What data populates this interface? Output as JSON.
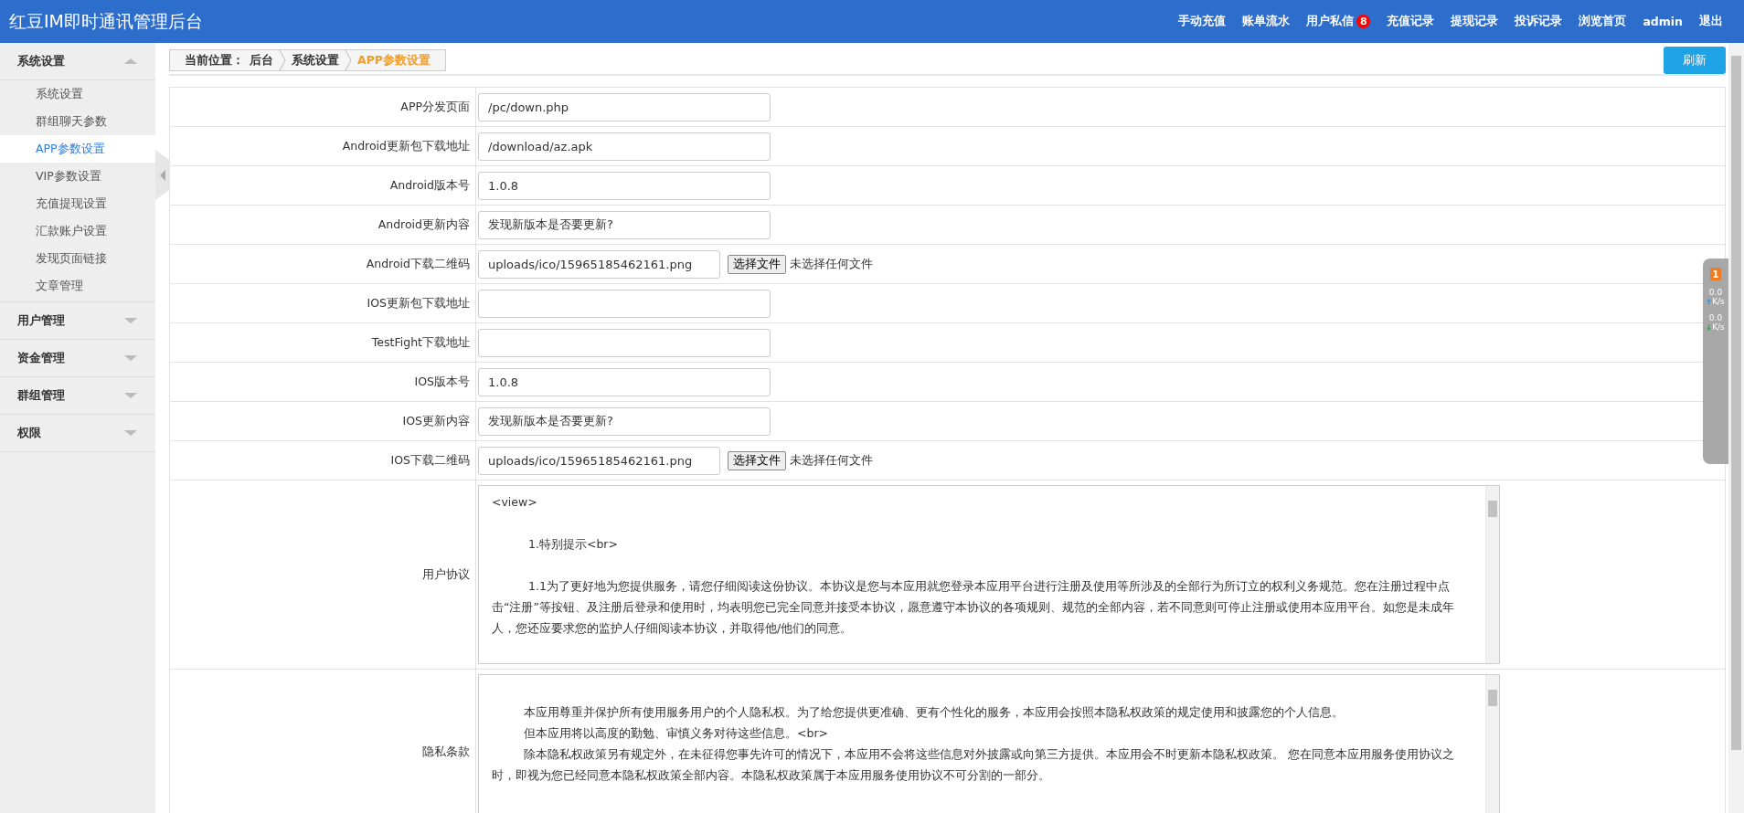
{
  "header": {
    "title": "红豆IM即时通讯管理后台",
    "nav": [
      {
        "label": "手动充值"
      },
      {
        "label": "账单流水"
      },
      {
        "label": "用户私信",
        "badge": "8"
      },
      {
        "label": "充值记录"
      },
      {
        "label": "提现记录"
      },
      {
        "label": "投诉记录"
      },
      {
        "label": "浏览首页"
      },
      {
        "label": "admin"
      },
      {
        "label": "退出"
      }
    ]
  },
  "sidebar": {
    "groups": [
      {
        "label": "系统设置",
        "expanded": true,
        "items": [
          {
            "label": "系统设置",
            "selected": false
          },
          {
            "label": "群组聊天参数",
            "selected": false
          },
          {
            "label": "APP参数设置",
            "selected": true
          },
          {
            "label": "VIP参数设置",
            "selected": false
          },
          {
            "label": "充值提现设置",
            "selected": false
          },
          {
            "label": "汇款账户设置",
            "selected": false
          },
          {
            "label": "发现页面链接",
            "selected": false
          },
          {
            "label": "文章管理",
            "selected": false
          }
        ]
      },
      {
        "label": "用户管理",
        "expanded": false
      },
      {
        "label": "资金管理",
        "expanded": false
      },
      {
        "label": "群组管理",
        "expanded": false
      },
      {
        "label": "权限",
        "expanded": false
      }
    ]
  },
  "breadcrumb": {
    "prefix": "当前位置：",
    "items": [
      {
        "label": "后台",
        "selected": false
      },
      {
        "label": "系统设置",
        "selected": false
      },
      {
        "label": "APP参数设置",
        "selected": true
      }
    ]
  },
  "refresh_button": "刷新",
  "form": {
    "rows": [
      {
        "kind": "text",
        "label": "APP分发页面",
        "value": "/pc/down.php"
      },
      {
        "kind": "text",
        "label": "Android更新包下载地址",
        "value": "/download/az.apk"
      },
      {
        "kind": "text",
        "label": "Android版本号",
        "value": "1.0.8"
      },
      {
        "kind": "text",
        "label": "Android更新内容",
        "value": "发现新版本是否要更新?"
      },
      {
        "kind": "file",
        "label": "Android下载二维码",
        "value": "uploads/ico/15965185462161.png",
        "button": "选择文件",
        "status": "未选择任何文件"
      },
      {
        "kind": "text",
        "label": "IOS更新包下载地址"
      },
      {
        "kind": "text",
        "label": "TestFight下载地址"
      },
      {
        "kind": "text",
        "label": "IOS版本号",
        "value": "1.0.8"
      },
      {
        "kind": "text",
        "label": "IOS更新内容",
        "value": "发现新版本是否要更新?"
      },
      {
        "kind": "file",
        "label": "IOS下载二维码",
        "value": "uploads/ico/15965185462161.png",
        "button": "选择文件",
        "status": "未选择任何文件"
      },
      {
        "kind": "textarea",
        "label": "用户协议",
        "paragraphs": [
          "<view>",
          "1.特别提示<br>",
          "1.1为了更好地为您提供服务，请您仔细阅读这份协议。本协议是您与本应用就您登录本应用平台进行注册及使用等所涉及的全部行为所订立的权利义务规范。您在注册过程中点击“注册”等按钮、及注册后登录和使用时，均表明您已完全同意并接受本协议，愿意遵守本协议的各项规则、规范的全部内容，若不同意则可停止注册或使用本应用平台。如您是未成年人，您还应要求您的监护人仔细阅读本协议，并取得他/他们的同意。"
        ]
      },
      {
        "kind": "textarea",
        "label": "隐私条款",
        "paragraphs": [
          "本应用尊重并保护所有使用服务用户的个人隐私权。为了给您提供更准确、更有个性化的服务，本应用会按照本隐私权政策的规定使用和披露您的个人信息。",
          "但本应用将以高度的勤勉、审慎义务对待这些信息。<br>",
          "除本隐私权政策另有规定外，在未征得您事先许可的情况下，本应用不会将这些信息对外披露或向第三方提供。本应用会不时更新本隐私权政策。 您在同意本应用服务使用协议之时，即视为您已经同意本隐私权政策全部内容。本隐私权政策属于本应用服务使用协议不可分割的一部分。"
        ]
      }
    ]
  },
  "speed_widget": {
    "badge": "1",
    "up": "0.0",
    "up_unit": "K/s",
    "down": "0.0",
    "down_unit": "K/s"
  }
}
